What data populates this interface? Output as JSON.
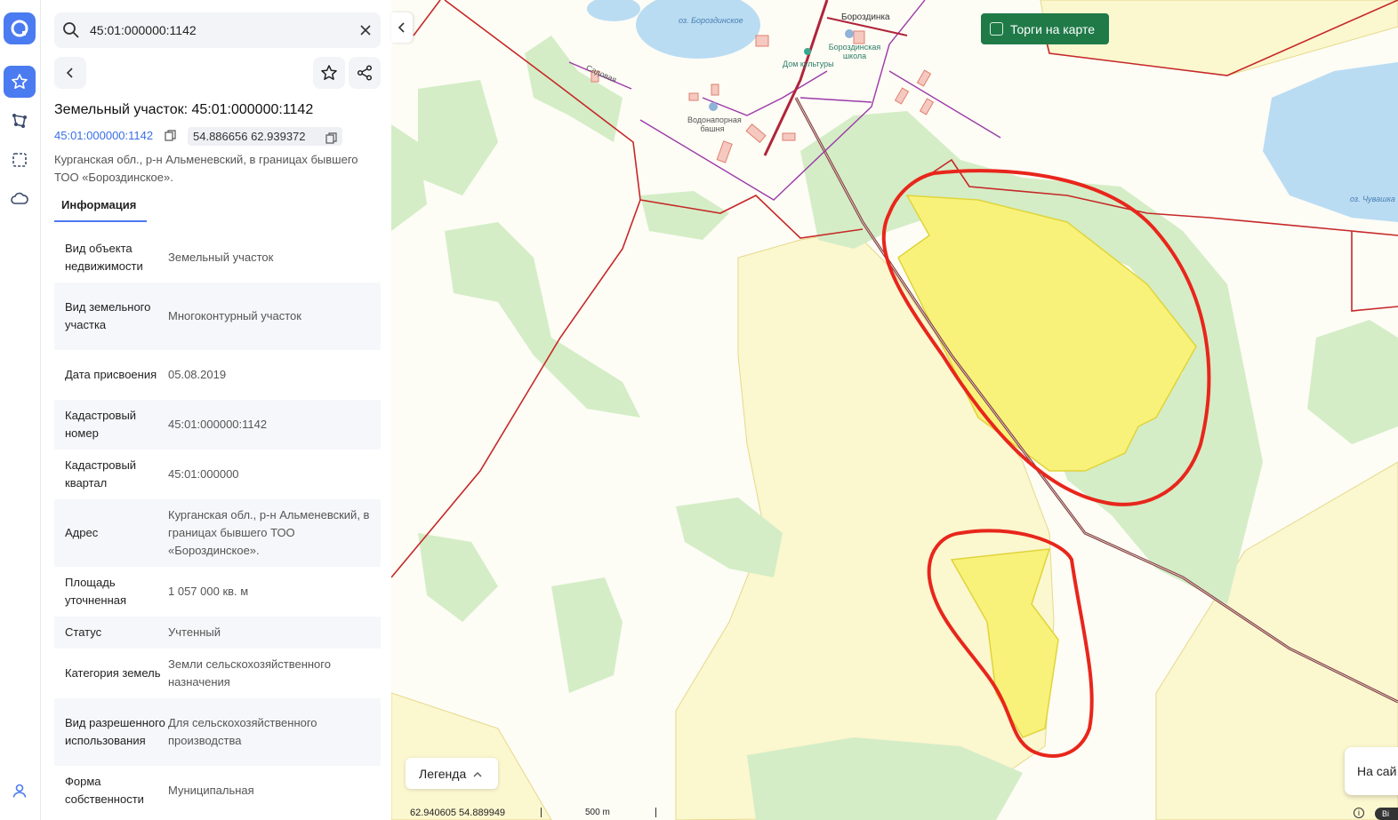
{
  "search": {
    "value": "45:01:000000:1142"
  },
  "parcel": {
    "title": "Земельный участок: 45:01:000000:1142",
    "cadastral_link": "45:01:000000:1142",
    "coords": "54.886656 62.939372",
    "address": "Курганская обл., р-н Альменевский, в границах бывшего ТОО «Бороздинское»."
  },
  "tabs": {
    "info": "Информация"
  },
  "info_rows": [
    {
      "key": "Вид объекта недвижимости",
      "value": "Земельный участок"
    },
    {
      "key": "Вид земельного участка",
      "value": "Многоконтурный участок"
    },
    {
      "key": "Дата присвоения",
      "value": "05.08.2019"
    },
    {
      "key": "Кадастровый номер",
      "value": "45:01:000000:1142"
    },
    {
      "key": "Кадастровый квартал",
      "value": "45:01:000000"
    },
    {
      "key": "Адрес",
      "value": " Курганская обл., р-н Альменевский, в границах бывшего ТОО «Бороздинское»."
    },
    {
      "key": "Площадь уточненная",
      "value": "1 057 000 кв. м"
    },
    {
      "key": "Статус",
      "value": "Учтенный"
    },
    {
      "key": "Категория земель",
      "value": "Земли сельскохозяйственного назначения"
    },
    {
      "key": "Вид разрешенного использования",
      "value": "Для сельскохозяйственного производства"
    },
    {
      "key": "Форма собственности",
      "value": "Муниципальная"
    }
  ],
  "map": {
    "auctions_label": "Торги на карте",
    "legend_label": "Легенда",
    "cursor_coords": "62.940605  54.889949",
    "scale_label": "500 m",
    "site_popup": "На сай",
    "badge": "Bi",
    "labels": {
      "lake_borozdinskoe": "оз. Бороздинское",
      "village": "Бороздинка",
      "school": "Бороздинская школа",
      "culture_house": "Дом культуры",
      "water_tower": "Водонапорная башня",
      "lake_chuvashka": "оз. Чувашка",
      "street": "Садовая"
    }
  },
  "colors": {
    "accent": "#4b7bf0",
    "auction_green": "#1f7a48",
    "boundary_red": "#c62828",
    "highlight_red": "#e8261c",
    "parcel_yellow": "#f8f27a",
    "forest_green": "#d4edc6",
    "water_blue": "#b9dcf3"
  }
}
